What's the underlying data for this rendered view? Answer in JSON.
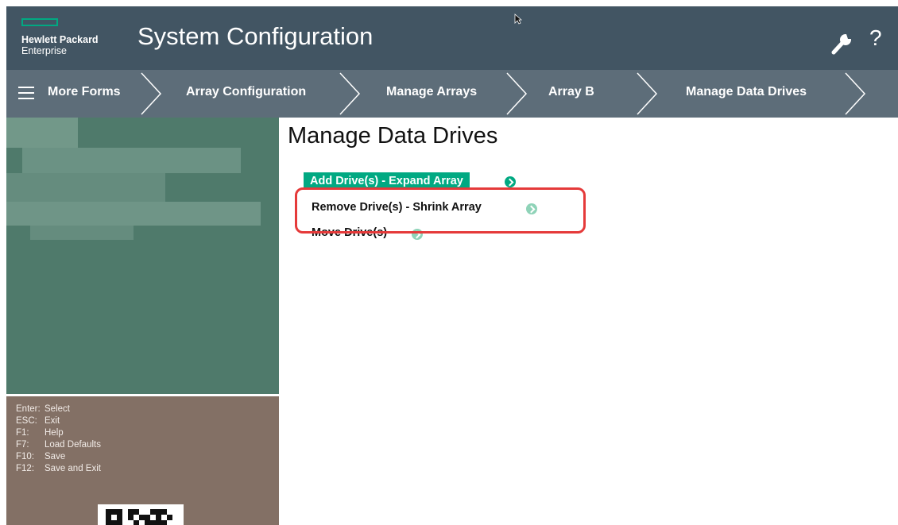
{
  "header": {
    "logo_line1": "Hewlett Packard",
    "logo_line2": "Enterprise",
    "title": "System Configuration",
    "help_label": "?"
  },
  "breadcrumb": {
    "menu_label": "More Forms",
    "items": [
      {
        "label": "Array Configuration"
      },
      {
        "label": "Manage Arrays"
      },
      {
        "label": "Array B"
      },
      {
        "label": "Manage Data Drives"
      }
    ]
  },
  "sidebar": {
    "keys": [
      {
        "key": "Enter:",
        "action": "Select"
      },
      {
        "key": "ESC:",
        "action": "Exit"
      },
      {
        "key": "F1:",
        "action": "Help"
      },
      {
        "key": "F7:",
        "action": "Load Defaults"
      },
      {
        "key": "F10:",
        "action": "Save"
      },
      {
        "key": "F12:",
        "action": "Save and Exit"
      }
    ]
  },
  "main": {
    "title": "Manage Data Drives",
    "options": [
      {
        "label": "Add Drive(s) - Expand Array",
        "selected": true
      },
      {
        "label": "Remove Drive(s) - Shrink Array",
        "selected": false
      },
      {
        "label": "Move Drive(s)",
        "selected": false
      }
    ]
  },
  "colors": {
    "header_bg": "#425563",
    "breadcrumb_bg": "#5d6d79",
    "accent": "#01a982",
    "sidebar_top_bg": "#4f7a6b",
    "sidebar_bottom_bg": "#837065",
    "highlight": "#e53a3a"
  },
  "icons": [
    "menu-icon",
    "wrench-icon",
    "help-icon",
    "go-arrow-icon",
    "qr-code-icon",
    "mouse-cursor"
  ]
}
